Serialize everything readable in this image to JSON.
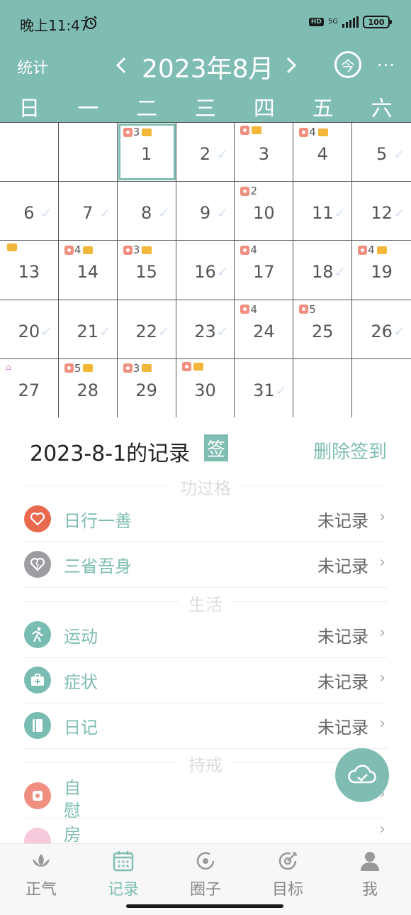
{
  "status_bar": {
    "time": "晚上11:47",
    "network_type": "5G",
    "hd": "HD",
    "battery": "100"
  },
  "header": {
    "stats_label": "统计",
    "month_title": "2023年8月",
    "today_label": "今",
    "more_label": "···",
    "weekdays": [
      "日",
      "一",
      "二",
      "三",
      "四",
      "五",
      "六"
    ]
  },
  "calendar": {
    "selected_day": "1",
    "weeks": [
      [
        {
          "day": "",
          "check": false,
          "tp": false,
          "count": "",
          "flag": false,
          "pink": false
        },
        {
          "day": "",
          "check": false,
          "tp": false,
          "count": "",
          "flag": false,
          "pink": false
        },
        {
          "day": "1",
          "check": false,
          "tp": true,
          "count": "3",
          "flag": true,
          "pink": false
        },
        {
          "day": "2",
          "check": true,
          "tp": false,
          "count": "",
          "flag": false,
          "pink": false
        },
        {
          "day": "3",
          "check": false,
          "tp": true,
          "count": "",
          "flag": true,
          "pink": false
        },
        {
          "day": "4",
          "check": false,
          "tp": true,
          "count": "4",
          "flag": true,
          "pink": false
        },
        {
          "day": "5",
          "check": true,
          "tp": false,
          "count": "",
          "flag": false,
          "pink": false
        }
      ],
      [
        {
          "day": "6",
          "check": true,
          "tp": false,
          "count": "",
          "flag": false,
          "pink": false
        },
        {
          "day": "7",
          "check": true,
          "tp": false,
          "count": "",
          "flag": false,
          "pink": false
        },
        {
          "day": "8",
          "check": true,
          "tp": false,
          "count": "",
          "flag": false,
          "pink": false
        },
        {
          "day": "9",
          "check": true,
          "tp": false,
          "count": "",
          "flag": false,
          "pink": false
        },
        {
          "day": "10",
          "check": false,
          "tp": true,
          "count": "2",
          "flag": false,
          "pink": false
        },
        {
          "day": "11",
          "check": true,
          "tp": false,
          "count": "",
          "flag": false,
          "pink": false
        },
        {
          "day": "12",
          "check": true,
          "tp": false,
          "count": "",
          "flag": false,
          "pink": false
        }
      ],
      [
        {
          "day": "13",
          "check": false,
          "tp": false,
          "count": "",
          "flag": true,
          "pink": false
        },
        {
          "day": "14",
          "check": false,
          "tp": true,
          "count": "4",
          "flag": true,
          "pink": false
        },
        {
          "day": "15",
          "check": false,
          "tp": true,
          "count": "3",
          "flag": true,
          "pink": false
        },
        {
          "day": "16",
          "check": true,
          "tp": false,
          "count": "",
          "flag": false,
          "pink": false
        },
        {
          "day": "17",
          "check": false,
          "tp": true,
          "count": "4",
          "flag": false,
          "pink": false
        },
        {
          "day": "18",
          "check": true,
          "tp": false,
          "count": "",
          "flag": false,
          "pink": false
        },
        {
          "day": "19",
          "check": false,
          "tp": true,
          "count": "4",
          "flag": true,
          "pink": false
        }
      ],
      [
        {
          "day": "20",
          "check": true,
          "tp": false,
          "count": "",
          "flag": false,
          "pink": false
        },
        {
          "day": "21",
          "check": true,
          "tp": false,
          "count": "",
          "flag": false,
          "pink": false
        },
        {
          "day": "22",
          "check": true,
          "tp": false,
          "count": "",
          "flag": false,
          "pink": false
        },
        {
          "day": "23",
          "check": true,
          "tp": false,
          "count": "",
          "flag": false,
          "pink": false
        },
        {
          "day": "24",
          "check": false,
          "tp": true,
          "count": "4",
          "flag": false,
          "pink": false
        },
        {
          "day": "25",
          "check": false,
          "tp": true,
          "count": "5",
          "flag": false,
          "pink": false
        },
        {
          "day": "26",
          "check": true,
          "tp": false,
          "count": "",
          "flag": false,
          "pink": false
        }
      ],
      [
        {
          "day": "27",
          "check": false,
          "tp": false,
          "count": "",
          "flag": false,
          "pink": true
        },
        {
          "day": "28",
          "check": false,
          "tp": true,
          "count": "5",
          "flag": true,
          "pink": false
        },
        {
          "day": "29",
          "check": false,
          "tp": true,
          "count": "3",
          "flag": true,
          "pink": false
        },
        {
          "day": "30",
          "check": false,
          "tp": true,
          "count": "",
          "flag": true,
          "pink": false
        },
        {
          "day": "31",
          "check": true,
          "tp": false,
          "count": "",
          "flag": false,
          "pink": false
        },
        {
          "day": "",
          "check": false,
          "tp": false,
          "count": "",
          "flag": false,
          "pink": false
        },
        {
          "day": "",
          "check": false,
          "tp": false,
          "count": "",
          "flag": false,
          "pink": false
        }
      ]
    ]
  },
  "record": {
    "title": "2023-8-1的记录",
    "sign_label": "签",
    "delete_sign_label": "删除签到",
    "groups": {
      "merit": "功过格",
      "life": "生活",
      "precepts": "持戒"
    },
    "rows": {
      "good_deed": {
        "label": "日行一善",
        "status": "未记录"
      },
      "reflection": {
        "label": "三省吾身",
        "status": "未记录"
      },
      "exercise": {
        "label": "运动",
        "status": "未记录"
      },
      "symptoms": {
        "label": "症状",
        "status": "未记录"
      },
      "diary": {
        "label": "日记",
        "status": "未记录"
      },
      "self_label": "自\n慰",
      "room_label": "房"
    }
  },
  "tabs": [
    {
      "label": "正气",
      "icon": "lotus-icon",
      "active": false
    },
    {
      "label": "记录",
      "icon": "calendar-icon",
      "active": true
    },
    {
      "label": "圈子",
      "icon": "circle-icon",
      "active": false
    },
    {
      "label": "目标",
      "icon": "target-icon",
      "active": false
    },
    {
      "label": "我",
      "icon": "user-icon",
      "active": false
    }
  ],
  "colors": {
    "accent": "#7fbdb3",
    "good_deed_icon": "#e9694f",
    "reflection_icon": "#9e9ca0",
    "teal_icon": "#78bcb2",
    "self_icon": "#f08f7f"
  }
}
